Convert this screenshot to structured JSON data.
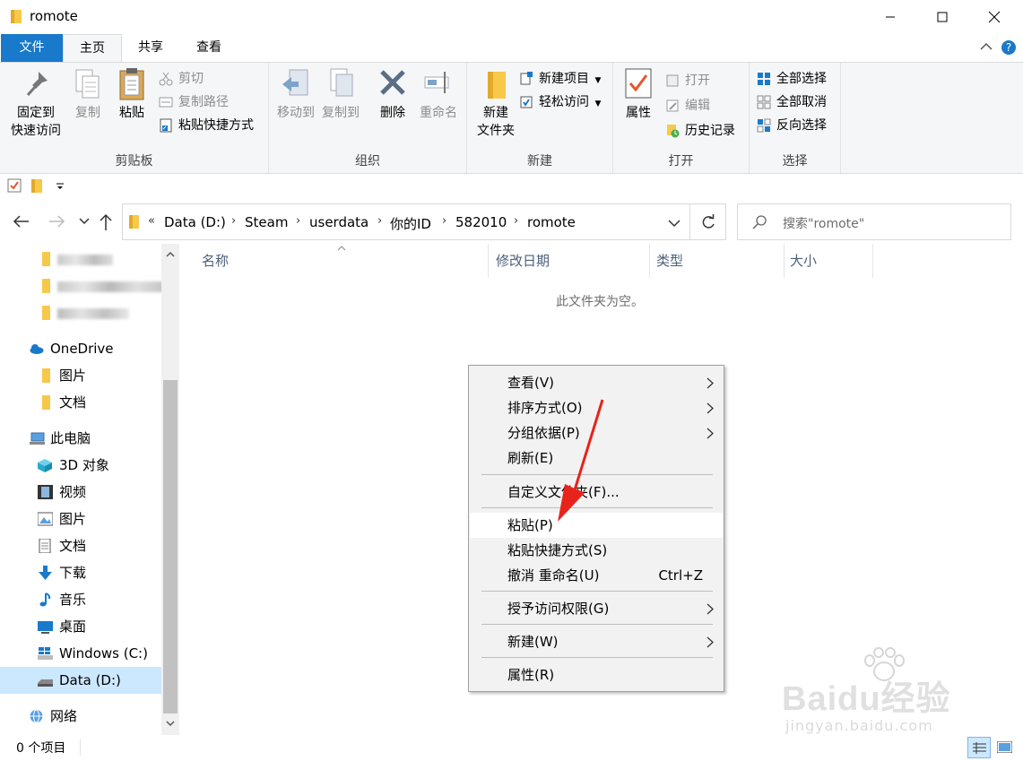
{
  "window": {
    "title": "romote"
  },
  "ribbon_tabs": {
    "file": "文件",
    "home": "主页",
    "share": "共享",
    "view": "查看"
  },
  "clipboard": {
    "pin": "固定到\n快速访问",
    "pin_l1": "固定到",
    "pin_l2": "快速访问",
    "copy": "复制",
    "paste": "粘贴",
    "cut": "剪切",
    "copy_path": "复制路径",
    "paste_shortcut": "粘贴快捷方式",
    "label": "剪贴板"
  },
  "organize": {
    "move_to": "移动到",
    "copy_to": "复制到",
    "delete": "删除",
    "rename": "重命名",
    "label": "组织"
  },
  "new_group": {
    "new_folder_l1": "新建",
    "new_folder_l2": "文件夹",
    "new_item": "新建项目",
    "easy_access": "轻松访问",
    "label": "新建"
  },
  "open_group": {
    "properties": "属性",
    "open": "打开",
    "edit": "编辑",
    "history": "历史记录",
    "label": "打开"
  },
  "select_group": {
    "select_all": "全部选择",
    "select_none": "全部取消",
    "invert": "反向选择",
    "label": "选择"
  },
  "address": {
    "overflow": "«",
    "crumbs": [
      "Data (D:)",
      "Steam",
      "userdata",
      "你的ID",
      "582010",
      "romote"
    ]
  },
  "search": {
    "placeholder": "搜索\"romote\""
  },
  "sidebar": {
    "onedrive": "OneDrive",
    "od_pictures": "图片",
    "od_documents": "文档",
    "this_pc": "此电脑",
    "objects3d": "3D 对象",
    "videos": "视频",
    "pictures": "图片",
    "documents": "文档",
    "downloads": "下载",
    "music": "音乐",
    "desktop": "桌面",
    "drive_c": "Windows (C:)",
    "drive_d": "Data (D:)",
    "network": "网络"
  },
  "columns": {
    "name": "名称",
    "modified": "修改日期",
    "type": "类型",
    "size": "大小"
  },
  "empty_message": "此文件夹为空。",
  "context_menu": {
    "view": "查看(V)",
    "sort": "排序方式(O)",
    "group": "分组依据(P)",
    "refresh": "刷新(E)",
    "customize": "自定义文件夹(F)...",
    "paste": "粘贴(P)",
    "paste_shortcut": "粘贴快捷方式(S)",
    "undo": "撤消 重命名(U)",
    "undo_shortcut": "Ctrl+Z",
    "grant": "授予访问权限(G)",
    "new": "新建(W)",
    "properties": "属性(R)"
  },
  "status": {
    "count": "0 个项目"
  },
  "watermark": {
    "brand": "Baidu经验",
    "url": "jingyan.baidu.com"
  },
  "colors": {
    "accent": "#1979ca",
    "folder": "#f8c84a",
    "arrow": "#e8231b"
  }
}
